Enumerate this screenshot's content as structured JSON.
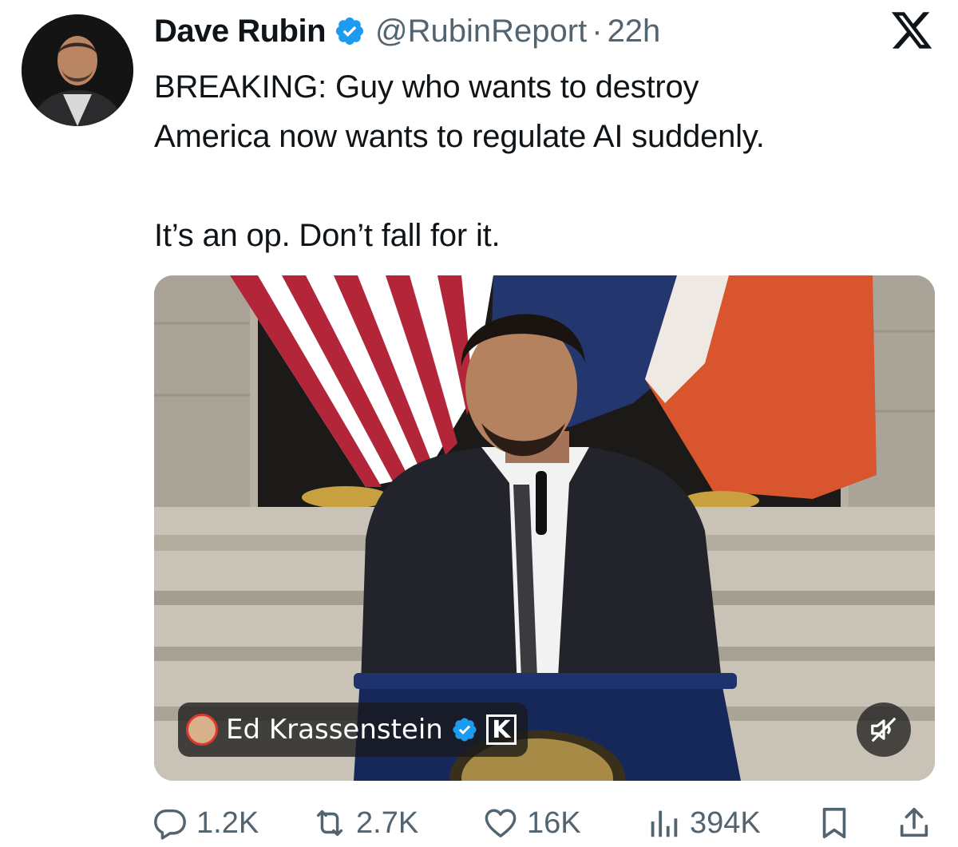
{
  "tweet": {
    "author_name": "Dave Rubin",
    "handle": "@RubinReport",
    "separator": "·",
    "time": "22h",
    "text_lines": [
      "BREAKING: Guy who wants to destroy",
      "America now wants to regulate AI suddenly."
    ],
    "text_line_2": "It’s an op. Don’t fall for it."
  },
  "media": {
    "creator_name": "Ed Krassenstein",
    "creator_badge_letter": "K",
    "mute_icon": "speaker-muted-icon"
  },
  "actions": {
    "replies": "1.2K",
    "reposts": "2.7K",
    "likes": "16K",
    "views": "394K"
  },
  "colors": {
    "verified_blue": "#1d9bf0",
    "text": "#0f1419",
    "secondary": "#536471"
  },
  "icons": {
    "reply": "reply-icon",
    "repost": "repost-icon",
    "like": "heart-icon",
    "views": "views-bar-icon",
    "bookmark": "bookmark-icon",
    "share": "share-icon",
    "brand": "x-logo-icon"
  }
}
